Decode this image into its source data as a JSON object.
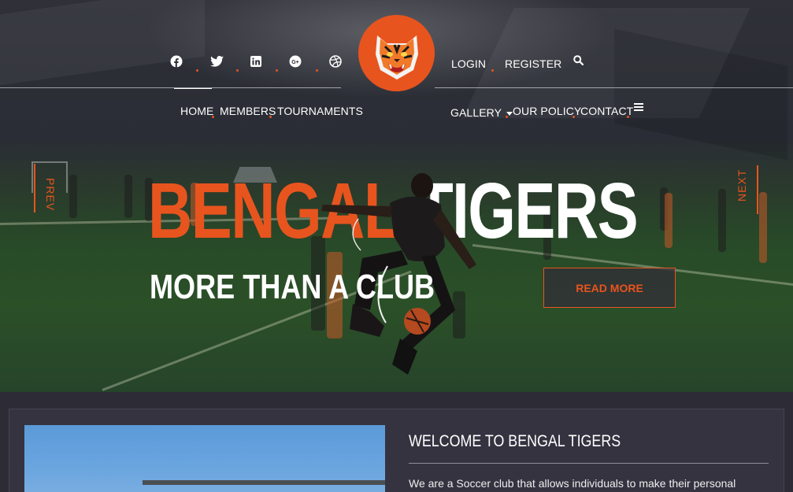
{
  "header": {
    "social": [
      {
        "icon": "facebook-icon",
        "glyph": "f"
      },
      {
        "icon": "twitter-icon",
        "glyph": "t"
      },
      {
        "icon": "linkedin-icon",
        "glyph": "in"
      },
      {
        "icon": "google-plus-icon",
        "glyph": "G+"
      },
      {
        "icon": "dribbble-icon",
        "glyph": "◍"
      }
    ],
    "login_label": "LOGIN",
    "register_label": "REGISTER",
    "search_icon": "search-icon",
    "logo_icon": "tiger-logo-icon",
    "menu_icon": "hamburger-menu-icon"
  },
  "nav": {
    "left": [
      "HOME",
      "MEMBERS",
      "TOURNAMENTS"
    ],
    "right": [
      "GALLERY",
      "OUR POLICY",
      "CONTACT"
    ],
    "active": "HOME"
  },
  "hero": {
    "prev_label": "PREV",
    "next_label": "NEXT",
    "title_word1": "BENGAL",
    "title_word2": "TIGERS",
    "subtitle": "MORE THAN A CLUB",
    "cta_label": "READ MORE"
  },
  "welcome": {
    "heading": "WELCOME TO BENGAL TIGERS",
    "text": "We are a Soccer club that allows individuals to make their personal"
  },
  "colors": {
    "accent": "#e8541e",
    "panel": "#353340",
    "background": "#2c2b36"
  }
}
